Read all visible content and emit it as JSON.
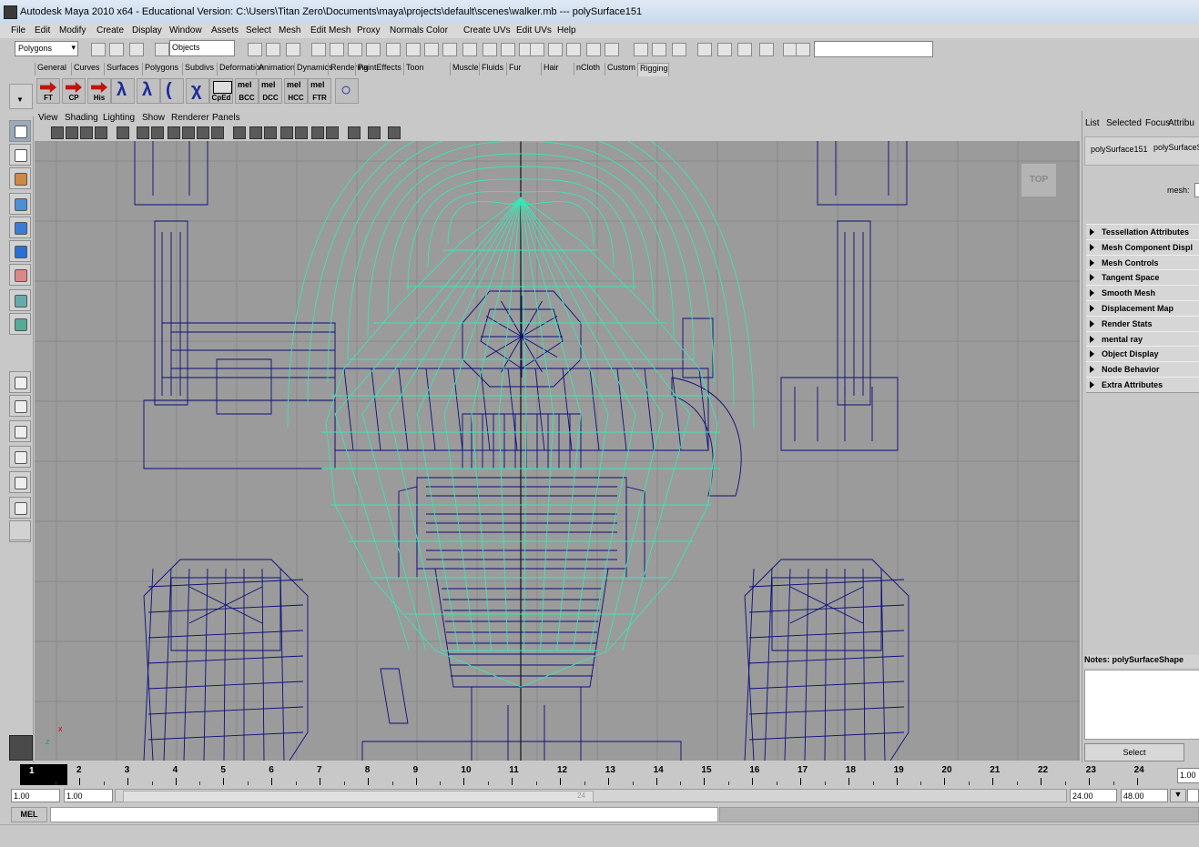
{
  "window": {
    "title": "Autodesk Maya 2010 x64 - Educational Version: C:\\Users\\Titan Zero\\Documents\\maya\\projects\\default\\scenes\\walker.mb   ---   polySurface151"
  },
  "menubar": [
    "File",
    "Edit",
    "Modify",
    "Create",
    "Display",
    "Window",
    "Assets",
    "Select",
    "Mesh",
    "Edit Mesh",
    "Proxy",
    "Normals",
    "Color",
    "Create UVs",
    "Edit UVs",
    "Help"
  ],
  "statusline": {
    "mode": "Polygons",
    "selection_field": "Objects"
  },
  "shelf_tabs": [
    "General",
    "Curves",
    "Surfaces",
    "Polygons",
    "Subdivs",
    "Deformation",
    "Animation",
    "Dynamics",
    "Rendering",
    "PaintEffects",
    "Toon",
    "Muscle",
    "Fluids",
    "Fur",
    "Hair",
    "nCloth",
    "Custom",
    "Rigging"
  ],
  "shelf_buttons": [
    "FT",
    "CP",
    "His",
    "",
    "",
    "",
    "",
    "CpEd",
    "BCC",
    "DCC",
    "HCC",
    "FTR",
    ""
  ],
  "shelf_mel_label": "mel",
  "panel_menu": [
    "View",
    "Shading",
    "Lighting",
    "Show",
    "Renderer",
    "Panels"
  ],
  "viewport": {
    "camera_label": "TOP",
    "axis_x": "x",
    "axis_y": "z"
  },
  "attribute_editor": {
    "menu": [
      "List",
      "Selected",
      "Focus",
      "Attribu"
    ],
    "node_tab_1": "polySurface151",
    "node_tab_2": "polySurfaceSh",
    "mesh_label": "mesh:",
    "sections": [
      "Tessellation Attributes",
      "Mesh Component Displ",
      "Mesh Controls",
      "Tangent Space",
      "Smooth Mesh",
      "Displacement Map",
      "Render Stats",
      "mental ray",
      "Object Display",
      "Node Behavior",
      "Extra Attributes"
    ],
    "notes_label": "Notes:  polySurfaceShape",
    "select_button": "Select"
  },
  "timeslider": {
    "current_frame": "1",
    "frames": [
      "1",
      "2",
      "3",
      "4",
      "5",
      "6",
      "7",
      "8",
      "9",
      "10",
      "11",
      "12",
      "13",
      "14",
      "15",
      "16",
      "17",
      "18",
      "19",
      "20",
      "21",
      "22",
      "23",
      "24"
    ],
    "current_time_field": "1.00"
  },
  "range_slider": {
    "start": "1.00",
    "start_inner": "1.00",
    "end_inner": "24.00",
    "end": "48.00",
    "range_label": "24"
  },
  "command_line": {
    "label": "MEL"
  },
  "colors": {
    "viewport_bg": "#9b9b9b",
    "wire_blue": "#0a0d7a",
    "wire_green": "#3ce6b4",
    "grid": "#8a8a8a"
  }
}
